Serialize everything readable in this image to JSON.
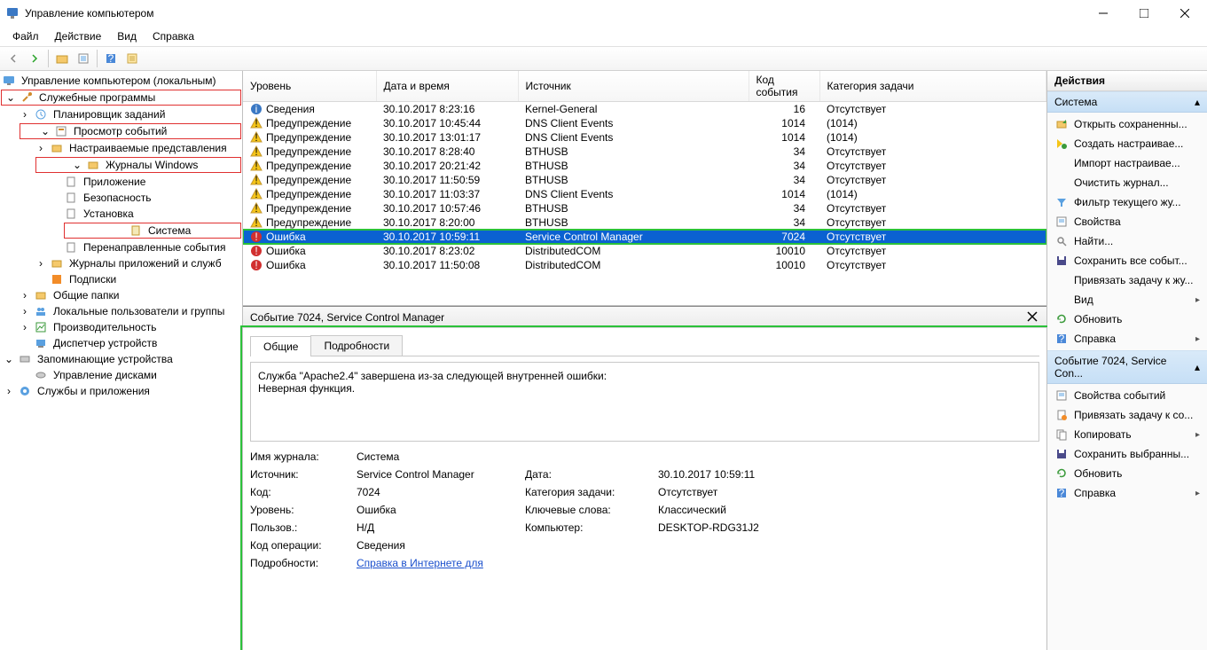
{
  "window": {
    "title": "Управление компьютером"
  },
  "menu": [
    "Файл",
    "Действие",
    "Вид",
    "Справка"
  ],
  "tree": {
    "root": "Управление компьютером (локальным)",
    "utils": "Служебные программы",
    "scheduler": "Планировщик заданий",
    "event_viewer": "Просмотр событий",
    "custom_views": "Настраиваемые представления",
    "win_logs": "Журналы Windows",
    "app": "Приложение",
    "security": "Безопасность",
    "setup": "Установка",
    "system": "Система",
    "forwarded": "Перенаправленные события",
    "app_services": "Журналы приложений и служб",
    "subs": "Подписки",
    "shared": "Общие папки",
    "users": "Локальные пользователи и группы",
    "perf": "Производительность",
    "devmgr": "Диспетчер устройств",
    "storage": "Запоминающие устройства",
    "diskmgr": "Управление дисками",
    "services": "Службы и приложения"
  },
  "columns": {
    "level": "Уровень",
    "date": "Дата и время",
    "source": "Источник",
    "id": "Код события",
    "category": "Категория задачи"
  },
  "rows": [
    {
      "lvl": "info",
      "lvl_text": "Сведения",
      "date": "30.10.2017 8:23:16",
      "src": "Kernel-General",
      "id": "16",
      "cat": "Отсутствует"
    },
    {
      "lvl": "warn",
      "lvl_text": "Предупреждение",
      "date": "30.10.2017 10:45:44",
      "src": "DNS Client Events",
      "id": "1014",
      "cat": "(1014)"
    },
    {
      "lvl": "warn",
      "lvl_text": "Предупреждение",
      "date": "30.10.2017 13:01:17",
      "src": "DNS Client Events",
      "id": "1014",
      "cat": "(1014)"
    },
    {
      "lvl": "warn",
      "lvl_text": "Предупреждение",
      "date": "30.10.2017 8:28:40",
      "src": "BTHUSB",
      "id": "34",
      "cat": "Отсутствует"
    },
    {
      "lvl": "warn",
      "lvl_text": "Предупреждение",
      "date": "30.10.2017 20:21:42",
      "src": "BTHUSB",
      "id": "34",
      "cat": "Отсутствует"
    },
    {
      "lvl": "warn",
      "lvl_text": "Предупреждение",
      "date": "30.10.2017 11:50:59",
      "src": "BTHUSB",
      "id": "34",
      "cat": "Отсутствует"
    },
    {
      "lvl": "warn",
      "lvl_text": "Предупреждение",
      "date": "30.10.2017 11:03:37",
      "src": "DNS Client Events",
      "id": "1014",
      "cat": "(1014)"
    },
    {
      "lvl": "warn",
      "lvl_text": "Предупреждение",
      "date": "30.10.2017 10:57:46",
      "src": "BTHUSB",
      "id": "34",
      "cat": "Отсутствует"
    },
    {
      "lvl": "warn",
      "lvl_text": "Предупреждение",
      "date": "30.10.2017 8:20:00",
      "src": "BTHUSB",
      "id": "34",
      "cat": "Отсутствует"
    },
    {
      "lvl": "error",
      "lvl_text": "Ошибка",
      "date": "30.10.2017 10:59:11",
      "src": "Service Control Manager",
      "id": "7024",
      "cat": "Отсутствует",
      "selected": true,
      "highlight": true
    },
    {
      "lvl": "error",
      "lvl_text": "Ошибка",
      "date": "30.10.2017 8:23:02",
      "src": "DistributedCOM",
      "id": "10010",
      "cat": "Отсутствует"
    },
    {
      "lvl": "error",
      "lvl_text": "Ошибка",
      "date": "30.10.2017 11:50:08",
      "src": "DistributedCOM",
      "id": "10010",
      "cat": "Отсутствует"
    }
  ],
  "detail": {
    "header": "Событие 7024, Service Control Manager",
    "tabs": {
      "general": "Общие",
      "details": "Подробности"
    },
    "message": "Служба \"Apache2.4\" завершена из-за следующей внутренней ошибки:\nНеверная функция.",
    "log_name_k": "Имя журнала:",
    "log_name_v": "Система",
    "source_k": "Источник:",
    "source_v": "Service Control Manager",
    "date_k": "Дата:",
    "date_v": "30.10.2017 10:59:11",
    "id_k": "Код:",
    "id_v": "7024",
    "cat_k": "Категория задачи:",
    "cat_v": "Отсутствует",
    "lvl_k": "Уровень:",
    "lvl_v": "Ошибка",
    "kw_k": "Ключевые слова:",
    "kw_v": "Классический",
    "user_k": "Пользов.:",
    "user_v": "Н/Д",
    "comp_k": "Компьютер:",
    "comp_v": "DESKTOP-RDG31J2",
    "op_k": "Код операции:",
    "op_v": "Сведения",
    "more_k": "Подробности:",
    "more_link": "Справка в Интернете для"
  },
  "actions": {
    "title": "Действия",
    "s1": "Система",
    "items1": [
      {
        "icon": "open",
        "label": "Открыть сохраненны..."
      },
      {
        "icon": "new",
        "label": "Создать настраивае..."
      },
      {
        "icon": "none",
        "label": "Импорт настраивае..."
      },
      {
        "icon": "none",
        "label": "Очистить журнал..."
      },
      {
        "icon": "filter",
        "label": "Фильтр текущего жу..."
      },
      {
        "icon": "props",
        "label": "Свойства"
      },
      {
        "icon": "find",
        "label": "Найти..."
      },
      {
        "icon": "save",
        "label": "Сохранить все событ..."
      },
      {
        "icon": "none",
        "label": "Привязать задачу к жу..."
      },
      {
        "icon": "none",
        "label": "Вид",
        "arrow": true
      },
      {
        "icon": "refresh",
        "label": "Обновить"
      },
      {
        "icon": "help",
        "label": "Справка",
        "arrow": true
      }
    ],
    "s2": "Событие 7024, Service Con...",
    "items2": [
      {
        "icon": "props",
        "label": "Свойства событий"
      },
      {
        "icon": "task",
        "label": "Привязать задачу к со..."
      },
      {
        "icon": "copy",
        "label": "Копировать",
        "arrow": true
      },
      {
        "icon": "save",
        "label": "Сохранить выбранны..."
      },
      {
        "icon": "refresh",
        "label": "Обновить"
      },
      {
        "icon": "help",
        "label": "Справка",
        "arrow": true
      }
    ]
  }
}
